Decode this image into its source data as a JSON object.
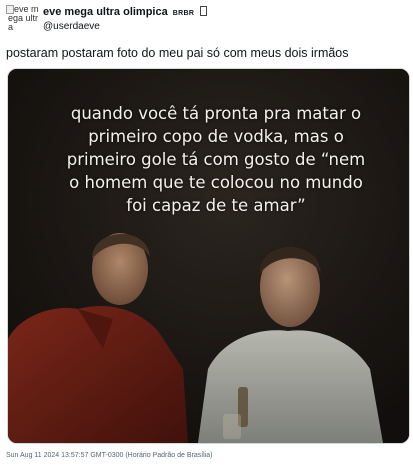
{
  "author": {
    "avatar_alt": "eve mega ultra",
    "display_name": "eve mega ultra olimpica",
    "name_badge": "BRBR",
    "handle": "@userdaeve"
  },
  "tweet": {
    "text": "postaram postaram foto do meu pai só com meus dois irmãos",
    "media_caption": "quando você tá pronta pra matar o primeiro copo de vodka, mas o primeiro gole tá com gosto de “nem o homem que te colocou no mundo foi capaz de te amar”",
    "timestamp": "Sun Aug 11 2024 13:57:57 GMT-0300 (Horário Padrão de Brasília)"
  },
  "colors": {
    "text_primary": "#0f1419",
    "text_secondary": "#536471",
    "media_border": "#cfd9de",
    "jacket_red": "#7a2418",
    "caption_text": "#f4f1ea"
  },
  "icons": {
    "avatar": "broken-image-icon",
    "name_emoji": "missing-glyph-icon"
  }
}
